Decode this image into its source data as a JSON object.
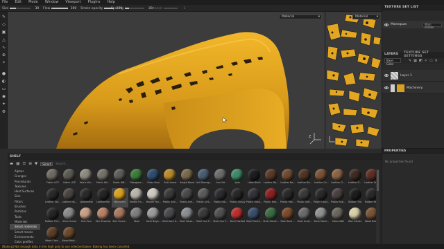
{
  "menu": [
    "File",
    "Edit",
    "Mode",
    "Window",
    "Viewport",
    "Plugins",
    "Help"
  ],
  "tool_options": [
    {
      "label": "Size",
      "value": "30",
      "fraction": 0.3
    },
    {
      "label": "Flow",
      "value": "100",
      "fraction": 1.0
    },
    {
      "label": "Stroke opacity",
      "value": "100",
      "fraction": 1.0
    },
    {
      "label": "Spacing",
      "value": "20",
      "fraction": 0.2
    },
    {
      "label": "Distance",
      "value": "1",
      "fraction": 0.0
    }
  ],
  "viewport": {
    "mode_select": "Material",
    "mode_select_2d": "Material"
  },
  "texture_set_list": {
    "title": "TEXTURE SET LIST",
    "item": "Manequas",
    "shader_label": "Main shader"
  },
  "layers": {
    "tab_layers": "LAYERS",
    "tab_settings": "TEXTURE SET SETTINGS",
    "blend_mode": "Base Color",
    "items": [
      {
        "name": "Layer 1"
      },
      {
        "name": "Machinery"
      }
    ]
  },
  "properties": {
    "title": "PROPERTIES",
    "empty_text": "No properties found"
  },
  "shelf": {
    "title": "SHELF",
    "filter_chip": "Smart",
    "search_placeholder": "Search...",
    "categories": [
      "Alphas",
      "Grunges",
      "Procedurals",
      "Textures",
      "Hard Surfaces",
      "Skin",
      "Filters",
      "Brushes",
      "Particles",
      "Tools",
      "Materials",
      "Smart materials",
      "Smart masks",
      "Environments",
      "Color profiles"
    ],
    "selected_category": "Smart materials",
    "materials": [
      {
        "name": "Fabric UCP",
        "color": "#6e6a63"
      },
      {
        "name": "Fabric UCP",
        "color": "#5b5a52"
      },
      {
        "name": "Fabric Wh...",
        "color": "#8e8a80"
      },
      {
        "name": "Fabric Wh...",
        "color": "#75716a"
      },
      {
        "name": "Fabric WB...",
        "color": "#5e5c57"
      },
      {
        "name": "Fiberglass...",
        "color": "#3e7a3a"
      },
      {
        "name": "Glass Visor",
        "color": "#2f4d6e"
      },
      {
        "name": "Gold Armor",
        "color": "#b88a2c"
      },
      {
        "name": "Height Blend",
        "color": "#7a6a4c"
      },
      {
        "name": "Hull Damag...",
        "color": "#4a5c72"
      },
      {
        "name": "Iron Old",
        "color": "#6b6b6b"
      },
      {
        "name": "Jade",
        "color": "#3f8a6a"
      },
      {
        "name": "Latex Black",
        "color": "#1e1e22"
      },
      {
        "name": "Leather Ba...",
        "color": "#5a3a28"
      },
      {
        "name": "Leather Ba...",
        "color": "#6e4a32"
      },
      {
        "name": "Leather Bo...",
        "color": "#4e3526"
      },
      {
        "name": "Leather Ca...",
        "color": "#7a5238"
      },
      {
        "name": "Leather Cl...",
        "color": "#8a6244"
      },
      {
        "name": "Leather Fi...",
        "color": "#3d2c22"
      },
      {
        "name": "Leather Sofa",
        "color": "#5e2e22"
      },
      {
        "name": "Leather Sof...",
        "color": "#2a2a2a"
      },
      {
        "name": "Leather Na...",
        "color": "#4a4440"
      },
      {
        "name": "Leatherette",
        "color": "#2d2b2a"
      },
      {
        "name": "Leatherette",
        "color": "#262424"
      },
      {
        "name": "Machinery",
        "color": "#d8a020"
      },
      {
        "name": "Marble Fin...",
        "color": "#b8b4ac"
      },
      {
        "name": "Marble Poli...",
        "color": "#cfcac0"
      },
      {
        "name": "Plastic Arm...",
        "color": "#3a3a3a"
      },
      {
        "name": "Plastic Arm...",
        "color": "#4a4a4a"
      },
      {
        "name": "Plastic Dirt...",
        "color": "#5a5a5a"
      },
      {
        "name": "Plastic Fab...",
        "color": "#2c2c30"
      },
      {
        "name": "Plastic Glossy",
        "color": "#282828"
      },
      {
        "name": "Plastic Hexa...",
        "color": "#333338"
      },
      {
        "name": "Plastic Mat...",
        "color": "#8a2222"
      },
      {
        "name": "Plastic Pain...",
        "color": "#2a2a2a"
      },
      {
        "name": "Plastic Soft...",
        "color": "#3a3a3a"
      },
      {
        "name": "Plastic Used...",
        "color": "#2a2a2a"
      },
      {
        "name": "Plastic Rub...",
        "color": "#4a4040"
      },
      {
        "name": "Rubber Tire",
        "color": "#1e1e1e"
      },
      {
        "name": "Rubber Re...",
        "color": "#2a2a2a"
      },
      {
        "name": "Rubber Tire...",
        "color": "#262626"
      },
      {
        "name": "Silver Armor",
        "color": "#8a8a8a"
      },
      {
        "name": "Skin Face",
        "color": "#c8a088"
      },
      {
        "name": "Skin Feverish",
        "color": "#b88068"
      },
      {
        "name": "Skin Huma...",
        "color": "#a87860"
      },
      {
        "name": "Steel",
        "color": "#7e7e80"
      },
      {
        "name": "Steel Brigh...",
        "color": "#9a9a9c"
      },
      {
        "name": "Steel Dark A...",
        "color": "#4a4a4e"
      },
      {
        "name": "Steel Galva...",
        "color": "#8a8e92"
      },
      {
        "name": "Steel Gun P...",
        "color": "#3a3a3a"
      },
      {
        "name": "Steel Gun P...",
        "color": "#505050"
      },
      {
        "name": "Steel Painted",
        "color": "#b83030"
      },
      {
        "name": "Steel Painte...",
        "color": "#3a4e6a"
      },
      {
        "name": "Steel Painte...",
        "color": "#3c6a44"
      },
      {
        "name": "Steel Rust ...",
        "color": "#7a4a2c"
      },
      {
        "name": "Steel Scrat...",
        "color": "#6a6a6c"
      },
      {
        "name": "Steel Stainl...",
        "color": "#909090"
      },
      {
        "name": "Stone Wall",
        "color": "#6a665e"
      },
      {
        "name": "Wax Candle",
        "color": "#d8cfa8"
      },
      {
        "name": "Wood Bea...",
        "color": "#7a5434"
      },
      {
        "name": "Wood Chec...",
        "color": "#5c3e26"
      },
      {
        "name": "Wood Walk...",
        "color": "#6a4a2e"
      }
    ],
    "selected_material": "Machinery"
  },
  "status_bar": "[Baking] Not enough data in the high poly to use selected baker. Baking has been canceled.",
  "colors": {
    "accent": "#d8a020",
    "status": "#e0a030"
  }
}
